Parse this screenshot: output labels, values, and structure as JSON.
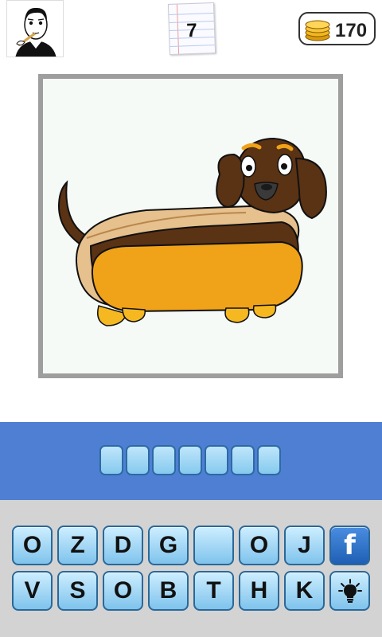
{
  "header": {
    "level_number": "7",
    "coins": "170"
  },
  "answer": {
    "slot_count": 7
  },
  "keyboard": {
    "row1": [
      "O",
      "Z",
      "D",
      "G",
      "",
      "O",
      "J"
    ],
    "row2": [
      "V",
      "S",
      "O",
      "B",
      "T",
      "H",
      "K"
    ],
    "facebook_label": "f"
  },
  "colors": {
    "answer_band": "#4f7fd3",
    "keyboard_bg": "#d3d3d3",
    "key_border": "#2b6898"
  }
}
